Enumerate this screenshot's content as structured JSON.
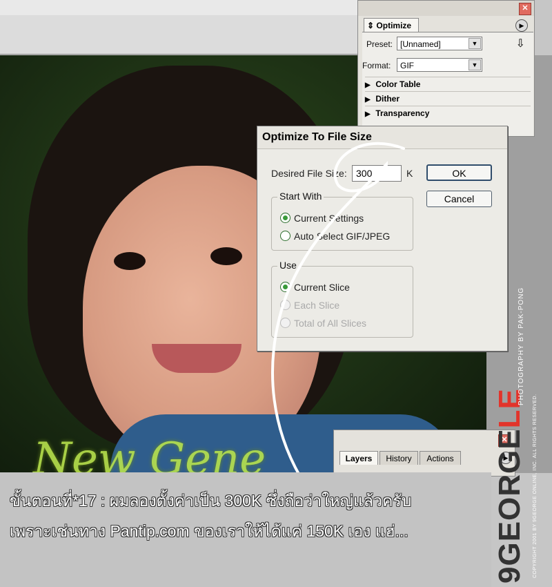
{
  "optimize_panel": {
    "tab_label": "Optimize",
    "preset_label": "Preset:",
    "preset_value": "[Unnamed]",
    "format_label": "Format:",
    "format_value": "GIF",
    "sections": [
      "Color Table",
      "Dither",
      "Transparency"
    ]
  },
  "dialog": {
    "title": "Optimize To File Size",
    "desired_label": "Desired File Size:",
    "desired_value": "300",
    "unit": "K",
    "ok_label": "OK",
    "cancel_label": "Cancel",
    "start_with": {
      "title": "Start With",
      "options": [
        {
          "label": "Current Settings",
          "selected": true,
          "enabled": true
        },
        {
          "label": "Auto Select GIF/JPEG",
          "selected": false,
          "enabled": true
        }
      ]
    },
    "use": {
      "title": "Use",
      "options": [
        {
          "label": "Current Slice",
          "selected": true,
          "enabled": true
        },
        {
          "label": "Each Slice",
          "selected": false,
          "enabled": false
        },
        {
          "label": "Total of All Slices",
          "selected": false,
          "enabled": false
        }
      ]
    }
  },
  "layers_panel": {
    "tabs": [
      "Layers",
      "History",
      "Actions"
    ],
    "active_tab": "Layers"
  },
  "caption": {
    "line1": "ขั้นตอนที่*17 : ผมลองตั้งค่าเป็น 300K ซึ่งถือว่าใหญ่แล้วครับ",
    "line2": "เพราะเช่นทาง Pantip.com ของเราให้ได้แค่ 150K เอง แฮ่..."
  },
  "branding": {
    "logo_main": "9GEORGE",
    "logo_accent": "LE",
    "credit": "PHOTOGRAPHY BY PAK-PONG",
    "copyright": "COPYRIGHT 2001 BY 9GEORGE ONLINE, INC. ALL RIGHTS RESERVED."
  },
  "colors": {
    "accent_red": "#e2342b",
    "script_green": "#b8e24c"
  }
}
